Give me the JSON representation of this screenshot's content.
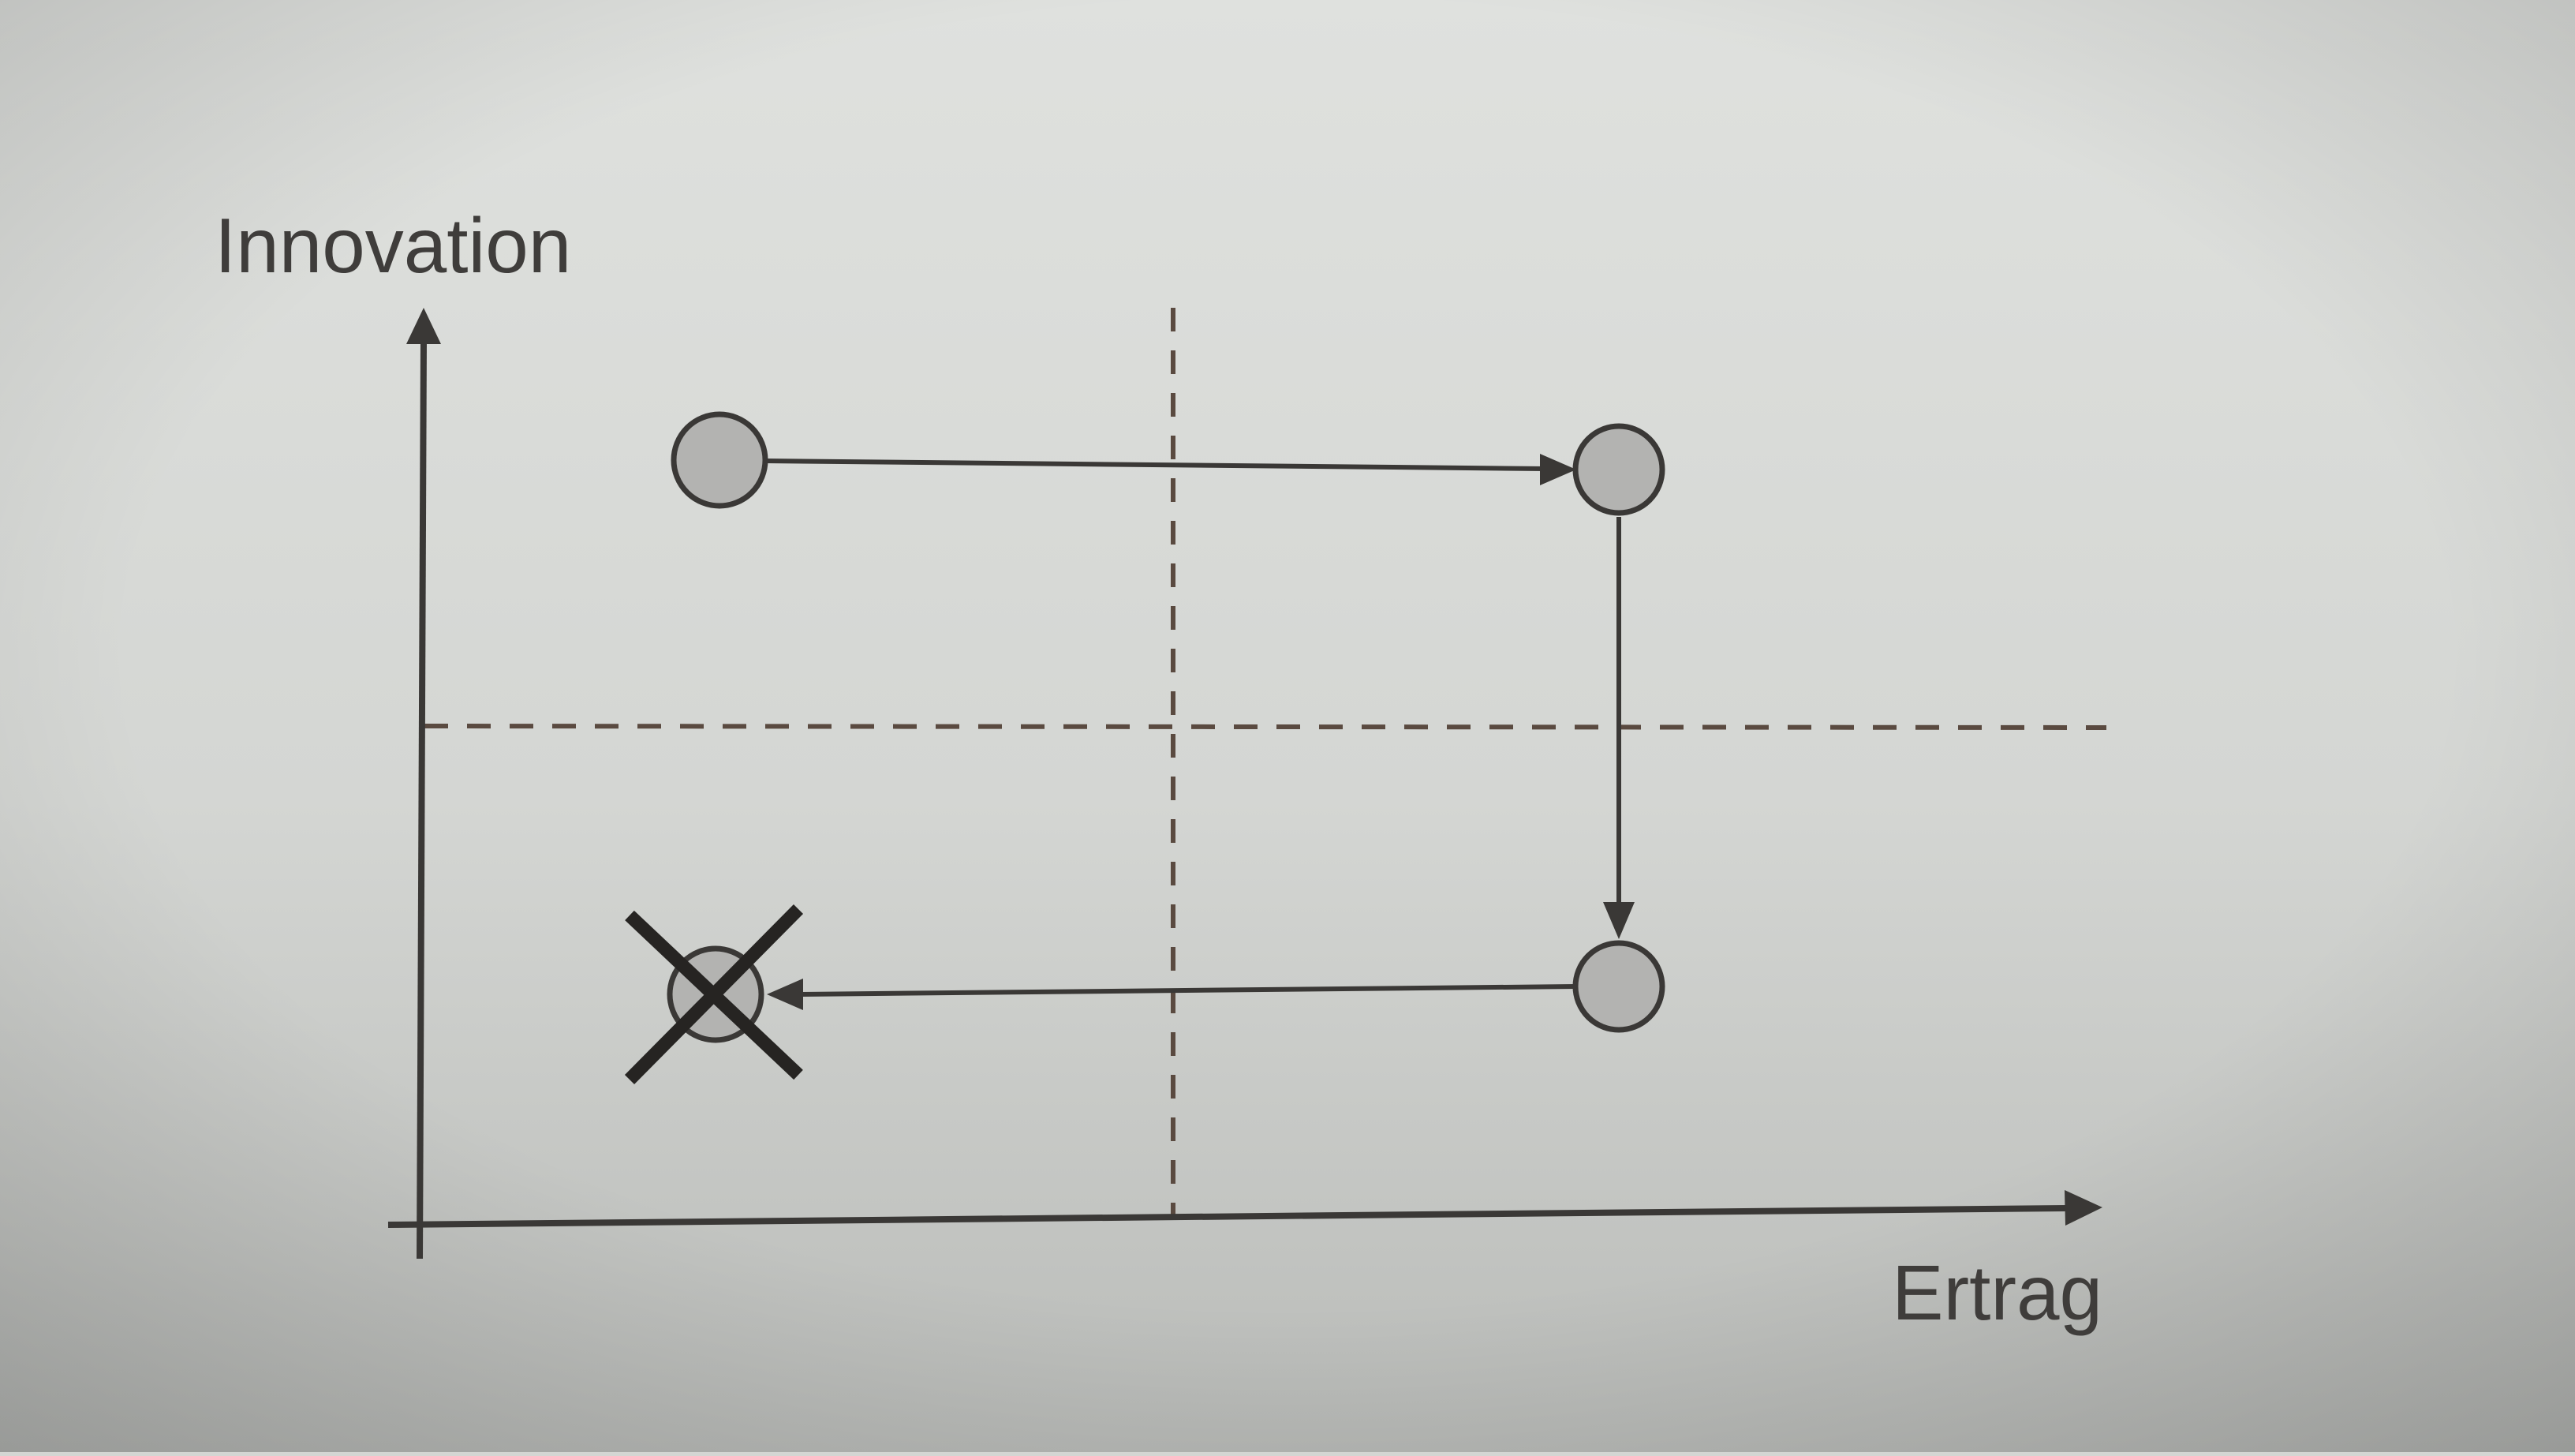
{
  "diagram": {
    "y_axis_label": "Innovation",
    "x_axis_label": "Ertrag",
    "nodes": [
      {
        "id": "start",
        "quadrant": "top-left",
        "crossed_out": false
      },
      {
        "id": "top-right",
        "quadrant": "top-right",
        "crossed_out": false
      },
      {
        "id": "bottom-right",
        "quadrant": "bottom-right",
        "crossed_out": false
      },
      {
        "id": "end",
        "quadrant": "bottom-left",
        "crossed_out": true
      }
    ],
    "edges": [
      {
        "from": "start",
        "to": "top-right"
      },
      {
        "from": "top-right",
        "to": "bottom-right"
      },
      {
        "from": "bottom-right",
        "to": "end"
      }
    ],
    "colors": {
      "paper": "#d4d6d3",
      "ink": "#3a3836",
      "dashed": "#5a4a40",
      "node_fill": "#b3b3b1"
    }
  }
}
